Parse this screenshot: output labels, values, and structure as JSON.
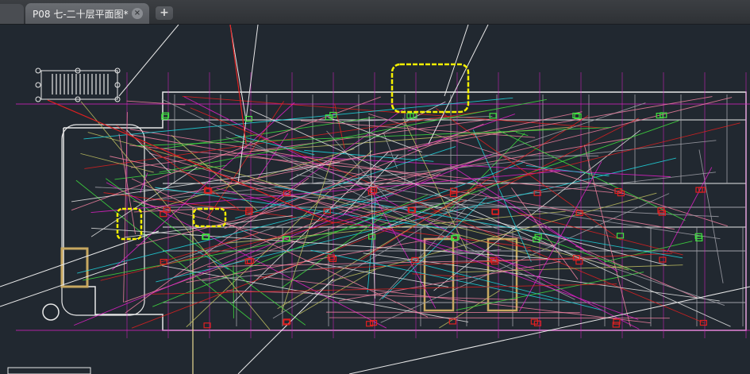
{
  "tabs": {
    "active_label": "P08 七-二十层平面图*",
    "close_glyph": "×",
    "new_glyph": "+"
  },
  "icons": {
    "close": "close-icon",
    "new_tab": "plus-icon"
  },
  "colors": {
    "background": "#212830",
    "magenta": "#e020c8",
    "red": "#e02020",
    "yellow": "#f5f000",
    "cyan": "#20d8e0",
    "green": "#40e040",
    "white": "#e8e8e8",
    "pink": "#f080a0",
    "grey": "#a0a0a8",
    "tan": "#c8a860"
  }
}
